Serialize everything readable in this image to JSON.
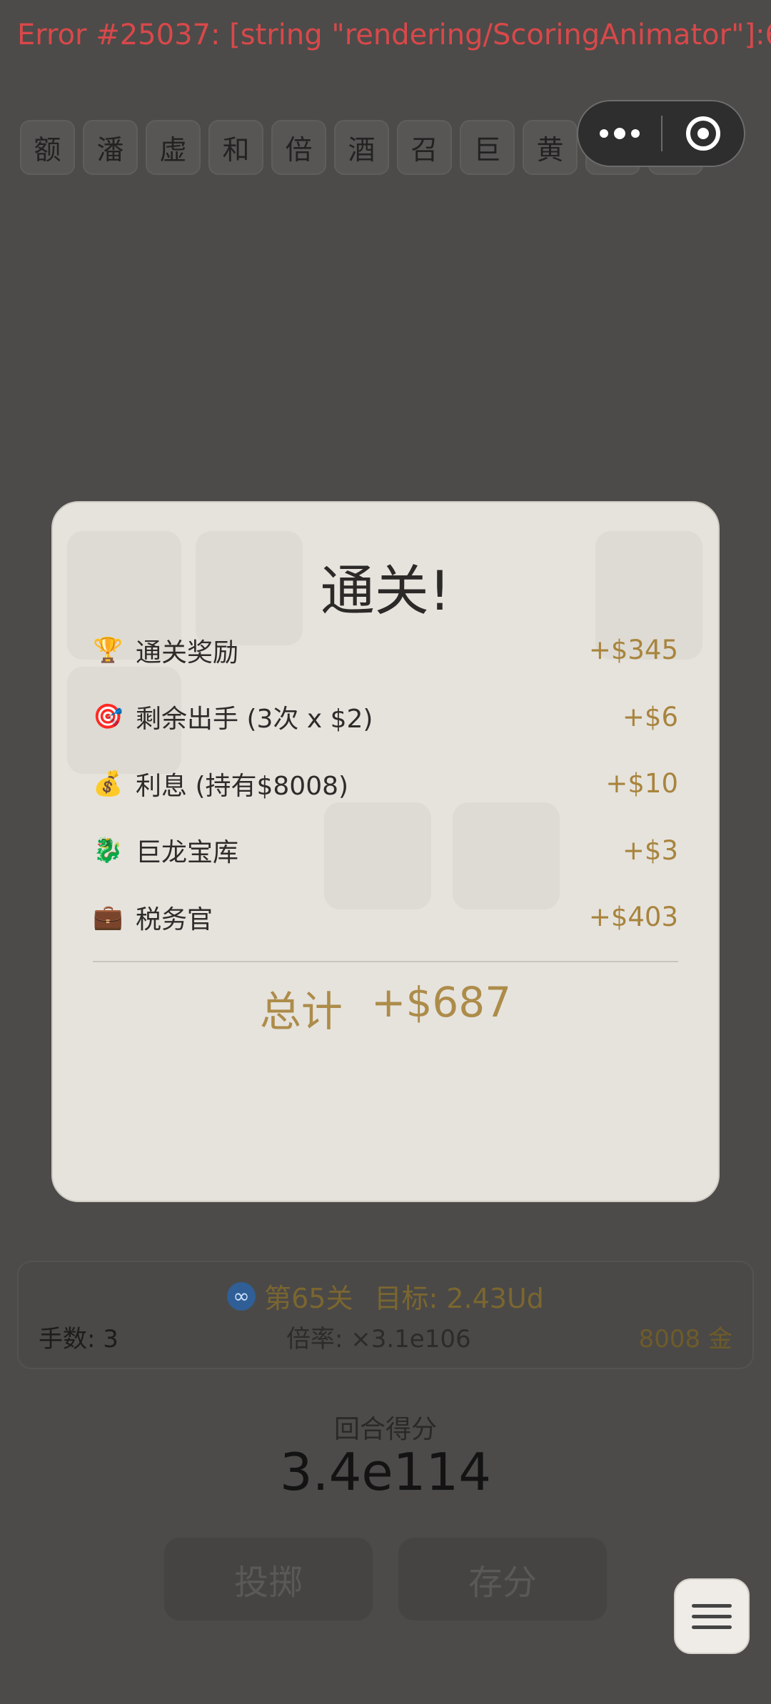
{
  "error": {
    "text": "Error #25037: [string \"rendering/ScoringAnimator\"]:619:"
  },
  "tiles": [
    "额",
    "潘",
    "虚",
    "和",
    "倍",
    "酒",
    "召",
    "巨",
    "黄",
    "巨",
    "指"
  ],
  "capsule": {
    "more_icon": "more-dots-icon",
    "target_icon": "target-icon"
  },
  "modal": {
    "title": "通关!",
    "rewards": [
      {
        "icon": "trophy-icon",
        "glyph": "🏆",
        "label": "通关奖励",
        "amount": "+$345"
      },
      {
        "icon": "dart-target-icon",
        "glyph": "🎯",
        "label": "剩余出手 (3次 x $2)",
        "amount": "+$6"
      },
      {
        "icon": "money-bag-icon",
        "glyph": "💰",
        "label": "利息 (持有$8008)",
        "amount": "+$10"
      },
      {
        "icon": "dragon-icon",
        "glyph": "🐉",
        "label": "巨龙宝库",
        "amount": "+$3"
      },
      {
        "icon": "briefcase-icon",
        "glyph": "💼",
        "label": "税务官",
        "amount": "+$403"
      }
    ],
    "total_label": "总计",
    "total_value": "+$687"
  },
  "info": {
    "loop_glyph": "∞",
    "level": "第65关",
    "target": "目标: 2.43Ud",
    "hands": "手数: 3",
    "multiplier": "倍率: ×3.1e106",
    "gold": "8008 金"
  },
  "round": {
    "label": "回合得分",
    "score": "3.4e114"
  },
  "buttons": {
    "roll": "投掷",
    "save": "存分"
  },
  "colors": {
    "backdrop": "#4c4b49",
    "modal_bg": "#e6e3dd",
    "gold_text": "#a8843d",
    "error_text": "#d9484a"
  }
}
